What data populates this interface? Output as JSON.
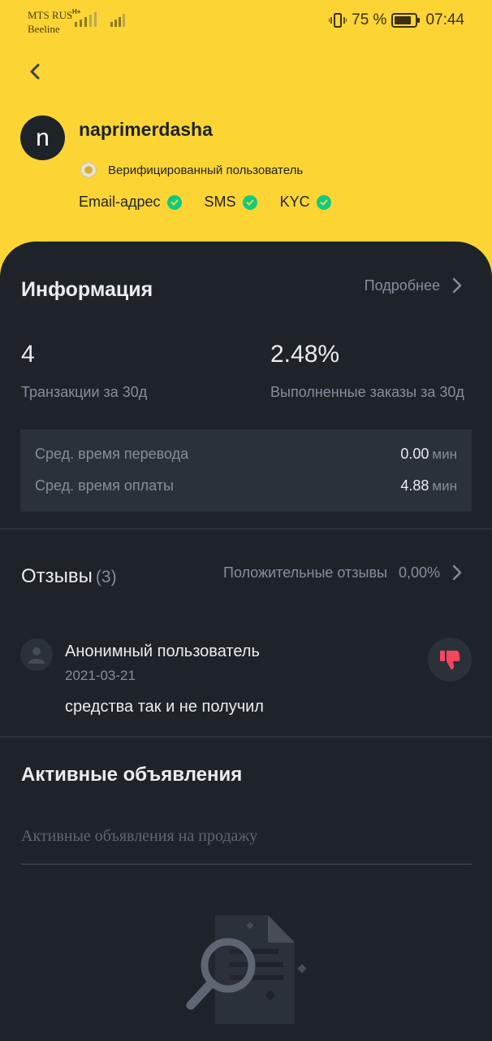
{
  "status_bar": {
    "carrier1": "MTS RUS",
    "carrier2": "Beeline",
    "network1": "H+",
    "battery": "75 %",
    "time": "07:44"
  },
  "profile": {
    "avatar_letter": "n",
    "username": "naprimerdasha",
    "verified_label": "Верифицированный пользователь",
    "badges": [
      "Email-адрес",
      "SMS",
      "KYC"
    ]
  },
  "info": {
    "title": "Информация",
    "more_label": "Подробнее",
    "stat1_value": "4",
    "stat1_label": "Транзакции за 30д",
    "stat2_value": "2.48%",
    "stat2_label": "Выполненные заказы за 30д",
    "times": [
      {
        "label": "Сред. время перевода",
        "value": "0.00",
        "unit": "мин"
      },
      {
        "label": "Сред. время оплаты",
        "value": "4.88",
        "unit": "мин"
      }
    ]
  },
  "reviews": {
    "title": "Отзывы",
    "count": "(3)",
    "positive_label": "Положительные отзывы",
    "positive_value": "0,00%",
    "item": {
      "author": "Анонимный пользователь",
      "date": "2021-03-21",
      "text": "средства так и не получил"
    }
  },
  "ads": {
    "title": "Активные объявления",
    "tab": "Активные объявления на продажу"
  },
  "colors": {
    "brand_yellow": "#fcd535",
    "background": "#1e2329",
    "positive": "#0ecb81",
    "negative": "#f6465d"
  }
}
